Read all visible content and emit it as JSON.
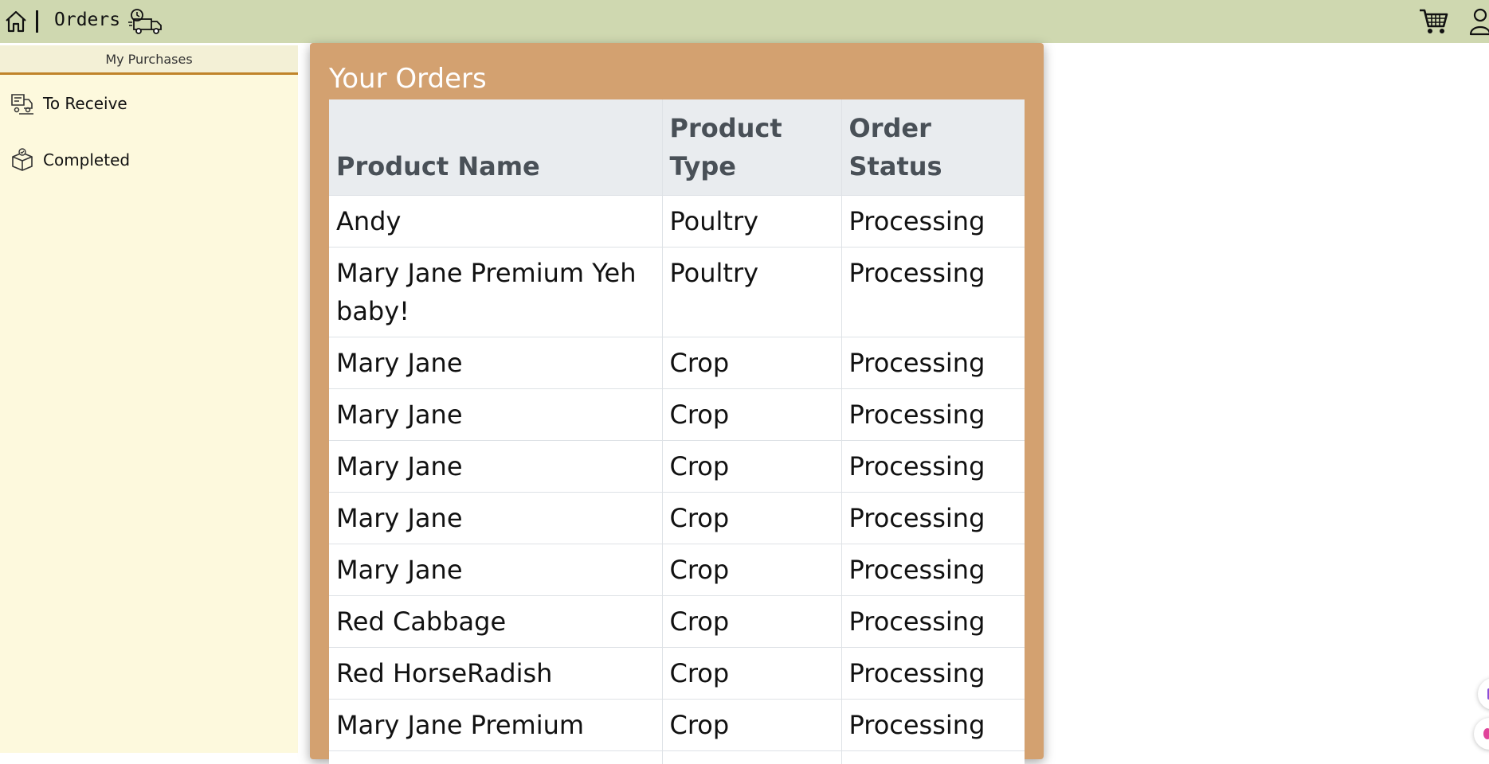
{
  "header": {
    "title": "Orders",
    "home_icon": "home-icon",
    "truck_icon": "delivery-truck-icon",
    "cart_icon": "cart-icon",
    "user_icon": "user-icon"
  },
  "sidebar": {
    "header": "My Purchases",
    "items": [
      {
        "label": "To Receive",
        "icon": "delivery-list-icon"
      },
      {
        "label": "Completed",
        "icon": "box-check-icon"
      }
    ]
  },
  "orders": {
    "title": "Your Orders",
    "columns": [
      "Product Name",
      "Product Type",
      "Order Status"
    ],
    "rows": [
      [
        "Andy",
        "Poultry",
        "Processing"
      ],
      [
        "Mary Jane Premium Yeh baby!",
        "Poultry",
        "Processing"
      ],
      [
        "Mary Jane",
        "Crop",
        "Processing"
      ],
      [
        "Mary Jane",
        "Crop",
        "Processing"
      ],
      [
        "Mary Jane",
        "Crop",
        "Processing"
      ],
      [
        "Mary Jane",
        "Crop",
        "Processing"
      ],
      [
        "Mary Jane",
        "Crop",
        "Processing"
      ],
      [
        "Red Cabbage",
        "Crop",
        "Processing"
      ],
      [
        "Red HorseRadish",
        "Crop",
        "Processing"
      ],
      [
        "Mary Jane Premium",
        "Crop",
        "Processing"
      ],
      [
        "",
        "",
        ""
      ]
    ]
  },
  "colors": {
    "topbar": "#cfd8b0",
    "sidebar": "#fdf9dd",
    "sidebar_accent": "#c0842a",
    "card": "#d3a170",
    "table_header": "#e9ecef"
  }
}
